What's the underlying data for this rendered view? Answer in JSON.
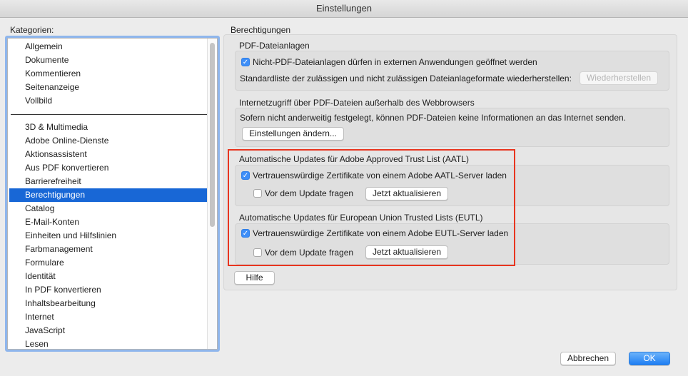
{
  "window": {
    "title": "Einstellungen"
  },
  "sidebar": {
    "heading": "Kategorien:",
    "items_top": [
      "Allgemein",
      "Dokumente",
      "Kommentieren",
      "Seitenanzeige",
      "Vollbild"
    ],
    "items_bottom": [
      "3D & Multimedia",
      "Adobe Online-Dienste",
      "Aktionsassistent",
      "Aus PDF konvertieren",
      "Barrierefreiheit",
      "Berechtigungen",
      "Catalog",
      "E-Mail-Konten",
      "Einheiten und Hilfslinien",
      "Farbmanagement",
      "Formulare",
      "Identität",
      "In PDF konvertieren",
      "Inhaltsbearbeitung",
      "Internet",
      "JavaScript",
      "Lesen"
    ],
    "selected": "Berechtigungen"
  },
  "main": {
    "section_title": "Berechtigungen",
    "pdf_attachments": {
      "title": "PDF-Dateianlagen",
      "checkbox_label": "Nicht-PDF-Dateianlagen dürfen in externen Anwendungen geöffnet werden",
      "checkbox_checked": true,
      "restore_text": "Standardliste der zulässigen und nicht zulässigen Dateianlageformate wiederherstellen:",
      "restore_button": "Wiederherstellen"
    },
    "internet_access": {
      "title": "Internetzugriff über PDF-Dateien außerhalb des Webbrowsers",
      "description": "Sofern nicht anderweitig festgelegt, können PDF-Dateien keine Informationen an das Internet senden.",
      "button": "Einstellungen ändern..."
    },
    "aatl": {
      "title": "Automatische Updates für Adobe Approved Trust List (AATL)",
      "checkbox_label": "Vertrauenswürdige Zertifikate von einem Adobe AATL-Server laden",
      "checkbox_checked": true,
      "ask_label": "Vor dem Update fragen",
      "ask_checked": false,
      "update_button": "Jetzt aktualisieren"
    },
    "eutl": {
      "title": "Automatische Updates für European Union Trusted Lists (EUTL)",
      "checkbox_label": "Vertrauenswürdige Zertifikate von einem Adobe EUTL-Server laden",
      "checkbox_checked": true,
      "ask_label": "Vor dem Update fragen",
      "ask_checked": false,
      "update_button": "Jetzt aktualisieren"
    },
    "help_button": "Hilfe"
  },
  "footer": {
    "cancel_button": "Abbrechen",
    "ok_button": "OK"
  },
  "colors": {
    "selection": "#1867d6",
    "checkbox_on": "#3d8ef8",
    "annotation": "#e8351f"
  },
  "icons": {
    "checkmark": "check-icon"
  }
}
